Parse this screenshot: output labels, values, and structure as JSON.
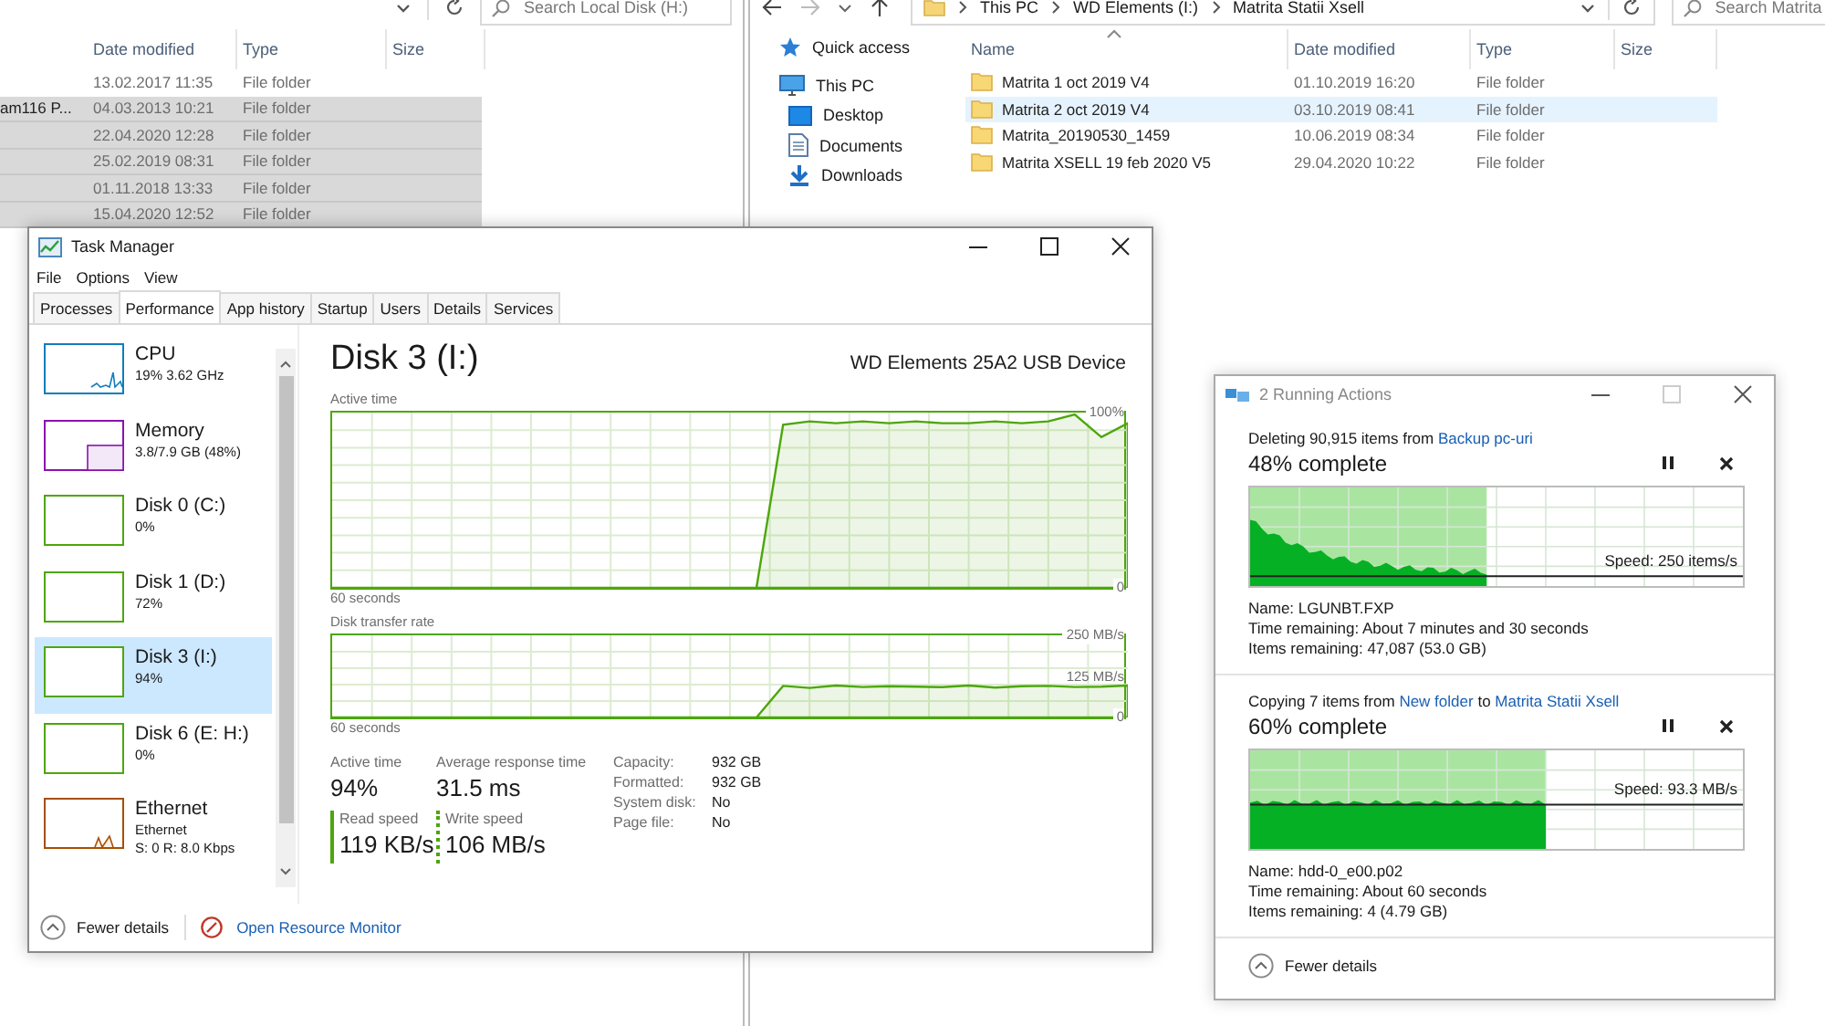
{
  "left_explorer": {
    "search": {
      "placeholder": "Search Local Disk (H:)"
    },
    "columns": [
      "Date modified",
      "Type",
      "Size"
    ],
    "rows": [
      {
        "date": "13.02.2017 11:35",
        "type": "File folder",
        "selected": false
      },
      {
        "name": "am116 P...",
        "date": "04.03.2013 10:21",
        "type": "File folder",
        "selected": true
      },
      {
        "date": "22.04.2020 12:28",
        "type": "File folder",
        "selected": true
      },
      {
        "date": "25.02.2019 08:31",
        "type": "File folder",
        "selected": true
      },
      {
        "date": "01.11.2018 13:33",
        "type": "File folder",
        "selected": true
      },
      {
        "date": "15.04.2020 12:52",
        "type": "File folder",
        "selected": true
      }
    ]
  },
  "right_explorer": {
    "breadcrumb": [
      "This PC",
      "WD Elements (I:)",
      "Matrita Statii Xsell"
    ],
    "search": {
      "placeholder": "Search Matrita"
    },
    "sidebar": [
      {
        "label": "Quick access",
        "kind": "star"
      },
      {
        "label": "This PC",
        "kind": "pc",
        "children": [
          {
            "label": "Desktop",
            "kind": "desktop"
          },
          {
            "label": "Documents",
            "kind": "documents"
          },
          {
            "label": "Downloads",
            "kind": "downloads"
          }
        ]
      }
    ],
    "columns": [
      "Name",
      "Date modified",
      "Type",
      "Size"
    ],
    "rows": [
      {
        "name": "Matrita 1 oct 2019 V4",
        "date": "01.10.2019 16:20",
        "type": "File folder",
        "selected": false
      },
      {
        "name": "Matrita 2 oct 2019 V4",
        "date": "03.10.2019 08:41",
        "type": "File folder",
        "selected": true
      },
      {
        "name": "Matrita_20190530_1459",
        "date": "10.06.2019 08:34",
        "type": "File folder",
        "selected": false
      },
      {
        "name": "Matrita XSELL 19 feb 2020 V5",
        "date": "29.04.2020 10:22",
        "type": "File folder",
        "selected": false
      }
    ]
  },
  "task_manager": {
    "title": "Task Manager",
    "menu": [
      "File",
      "Options",
      "View"
    ],
    "tabs": [
      {
        "label": "Processes",
        "selected": false
      },
      {
        "label": "Performance",
        "selected": true
      },
      {
        "label": "App history",
        "selected": false
      },
      {
        "label": "Startup",
        "selected": false
      },
      {
        "label": "Users",
        "selected": false
      },
      {
        "label": "Details",
        "selected": false
      },
      {
        "label": "Services",
        "selected": false
      }
    ],
    "devices": [
      {
        "kind": "cpu",
        "name": "CPU",
        "details": [
          "19% 3.62 GHz"
        ],
        "selected": false
      },
      {
        "kind": "memory",
        "name": "Memory",
        "details": [
          "3.8/7.9 GB (48%)"
        ],
        "selected": false
      },
      {
        "kind": "disk",
        "name": "Disk 0 (C:)",
        "details": [
          "0%"
        ],
        "selected": false
      },
      {
        "kind": "disk",
        "name": "Disk 1 (D:)",
        "details": [
          "72%"
        ],
        "selected": false
      },
      {
        "kind": "disk",
        "name": "Disk 3 (I:)",
        "details": [
          "94%"
        ],
        "selected": true
      },
      {
        "kind": "disk",
        "name": "Disk 6 (E: H:)",
        "details": [
          "0%"
        ],
        "selected": false
      },
      {
        "kind": "ethernet",
        "name": "Ethernet",
        "details": [
          "Ethernet",
          "S: 0 R: 8.0 Kbps"
        ],
        "selected": false
      }
    ],
    "heading": "Disk 3 (I:)",
    "device": "WD Elements 25A2 USB Device",
    "charts": [
      {
        "chart_data": {
          "type": "area",
          "title": "Active time",
          "xlabel": "60 seconds",
          "grid": true,
          "ylim": [
            0,
            100
          ],
          "yticks": [
            {
              "value": 0,
              "label": "0"
            },
            {
              "value": 100,
              "label": "100%"
            }
          ],
          "series": [
            {
              "color": "#4da60c",
              "values": [
                0,
                0,
                0,
                0,
                0,
                0,
                0,
                0,
                0,
                0,
                0,
                0,
                0,
                0,
                0,
                0,
                0,
                93,
                95,
                94,
                95,
                94,
                95,
                94,
                94,
                95,
                94,
                95,
                99,
                86,
                94
              ]
            }
          ]
        }
      },
      {
        "chart_data": {
          "type": "area",
          "title": "Disk transfer rate",
          "xlabel": "60 seconds",
          "grid": true,
          "ylim": [
            0,
            250
          ],
          "yticks": [
            {
              "value": 0,
              "label": "0"
            },
            {
              "value": 125,
              "label": "125 MB/s"
            },
            {
              "value": 250,
              "label": "250 MB/s"
            }
          ],
          "series": [
            {
              "color": "#4da60c",
              "values": [
                0,
                0,
                0,
                0,
                0,
                0,
                0,
                0,
                0,
                0,
                0,
                0,
                0,
                0,
                0,
                0,
                0,
                96,
                90,
                97,
                93,
                95,
                94,
                92,
                97,
                91,
                95,
                96,
                93,
                94,
                97
              ]
            }
          ]
        }
      }
    ],
    "stats": [
      {
        "label": "Active time",
        "value": "94%"
      },
      {
        "label": "Average response time",
        "value": "31.5 ms"
      }
    ],
    "speeds": [
      {
        "kind": "read",
        "label": "Read speed",
        "value": "119 KB/s"
      },
      {
        "kind": "write",
        "label": "Write speed",
        "value": "106 MB/s"
      }
    ],
    "properties": [
      {
        "label": "Capacity:",
        "value": "932 GB"
      },
      {
        "label": "Formatted:",
        "value": "932 GB"
      },
      {
        "label": "System disk:",
        "value": "No"
      },
      {
        "label": "Page file:",
        "value": "No"
      }
    ],
    "footer": {
      "fewer": "Fewer details",
      "monitor": "Open Resource Monitor"
    }
  },
  "running_actions": {
    "title": "2 Running Actions",
    "operations": [
      {
        "kind": "delete",
        "headline": [
          {
            "text": "Deleting 90,915 items from",
            "link": false
          },
          {
            "text": "Backup pc-uri",
            "link": true
          }
        ],
        "progress": "48% complete",
        "level": 0.48,
        "speed": "Speed: 250 items/s",
        "details": [
          "Name: LGUNBT.FXP",
          "Time remaining: About 7 minutes and 30 seconds",
          "Items remaining: 47,087 (53.0 GB)"
        ]
      },
      {
        "kind": "copy",
        "headline": [
          {
            "text": "Copying 7 items from",
            "link": false
          },
          {
            "text": "New folder",
            "link": true
          },
          {
            "text": "to",
            "link": false
          },
          {
            "text": "Matrita Statii Xsell",
            "link": true
          }
        ],
        "progress": "60% complete",
        "level": 0.6,
        "speed": "Speed: 93.3 MB/s",
        "details": [
          "Name: hdd-0_e00.p02",
          "Time remaining: About 60 seconds",
          "Items remaining: 4 (4.79 GB)"
        ]
      }
    ],
    "footer": "Fewer details"
  }
}
